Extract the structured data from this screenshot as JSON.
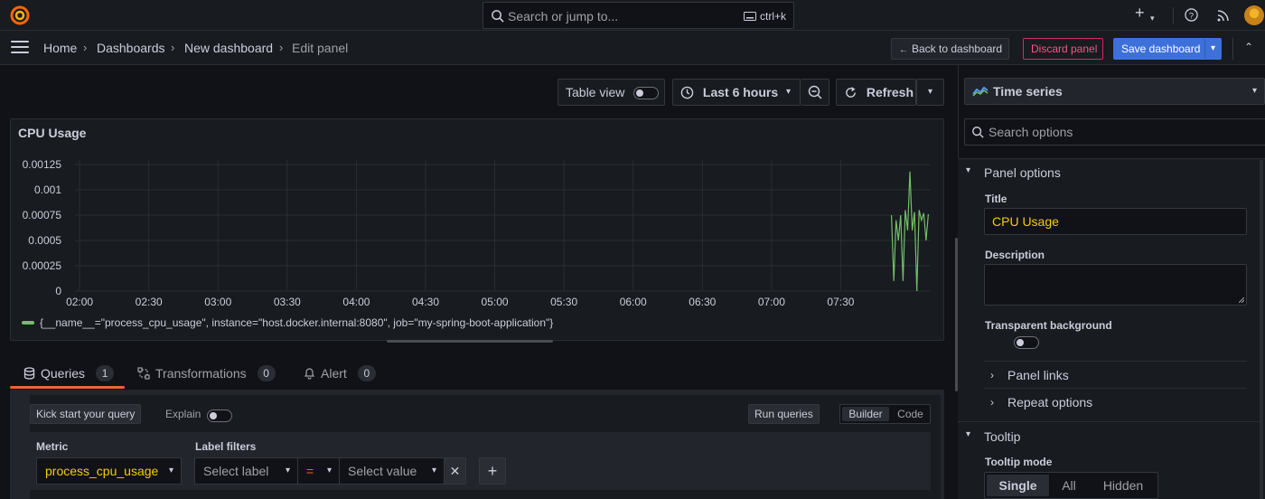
{
  "topbar": {
    "search_placeholder": "Search or jump to...",
    "search_shortcut": "ctrl+k"
  },
  "breadcrumb": [
    "Home",
    "Dashboards",
    "New dashboard",
    "Edit panel"
  ],
  "nav_actions": {
    "back": "Back to dashboard",
    "discard": "Discard panel",
    "save": "Save dashboard"
  },
  "panel_toolbar": {
    "table_view": "Table view",
    "time_range": "Last 6 hours",
    "refresh": "Refresh"
  },
  "panel": {
    "title": "CPU Usage",
    "legend": "{__name__=\"process_cpu_usage\", instance=\"host.docker.internal:8080\", job=\"my-spring-boot-application\"}"
  },
  "chart_data": {
    "type": "line",
    "title": "CPU Usage",
    "x_ticks": [
      "02:00",
      "02:30",
      "03:00",
      "03:30",
      "04:00",
      "04:30",
      "05:00",
      "05:30",
      "06:00",
      "06:30",
      "07:00",
      "07:30"
    ],
    "y_ticks": [
      "0",
      "0.00025",
      "0.0005",
      "0.00075",
      "0.001",
      "0.00125"
    ],
    "ylim": [
      0,
      0.00125
    ],
    "grid": true,
    "legend_placement": "bottom-left",
    "series": [
      {
        "name": "{__name__=\"process_cpu_usage\", instance=\"host.docker.internal:8080\", job=\"my-spring-boot-application\"}",
        "color": "#73bf69",
        "x": [
          "07:52",
          "07:53",
          "07:54",
          "07:55",
          "07:56",
          "07:57",
          "07:58",
          "07:59",
          "08:00",
          "08:01",
          "08:02",
          "08:03",
          "08:04",
          "08:05",
          "08:06",
          "08:07",
          "08:08"
        ],
        "values": [
          0.00075,
          0.0001,
          0.0007,
          0.0005,
          0.00075,
          0.0001,
          0.0008,
          0.0006,
          0.00118,
          0.0006,
          0.00078,
          0.0,
          0.0008,
          0.0007,
          0.00077,
          0.0005,
          0.00076
        ]
      }
    ]
  },
  "query_tabs": [
    {
      "label": "Queries",
      "count": "1"
    },
    {
      "label": "Transformations",
      "count": "0"
    },
    {
      "label": "Alert",
      "count": "0"
    }
  ],
  "query_editor": {
    "kick_start": "Kick start your query",
    "explain": "Explain",
    "run_queries": "Run queries",
    "mode_builder": "Builder",
    "mode_code": "Code",
    "metric_label": "Metric",
    "metric_value": "process_cpu_usage",
    "label_filters_label": "Label filters",
    "select_label": "Select label",
    "operator": "=",
    "select_value": "Select value"
  },
  "options": {
    "viz_type": "Time series",
    "search_placeholder": "Search options",
    "panel_options": "Panel options",
    "title_label": "Title",
    "title_value": "CPU Usage",
    "description_label": "Description",
    "transparent_label": "Transparent background",
    "panel_links": "Panel links",
    "repeat_options": "Repeat options",
    "tooltip": "Tooltip",
    "tooltip_mode_label": "Tooltip mode",
    "tooltip_modes": [
      "Single",
      "All",
      "Hidden"
    ]
  },
  "colors": {
    "accent": "#3d71d9",
    "series": "#73bf69",
    "danger": "#ff5286",
    "tab_active": "#f55f3e",
    "metric_text": "#f2cc0c"
  }
}
